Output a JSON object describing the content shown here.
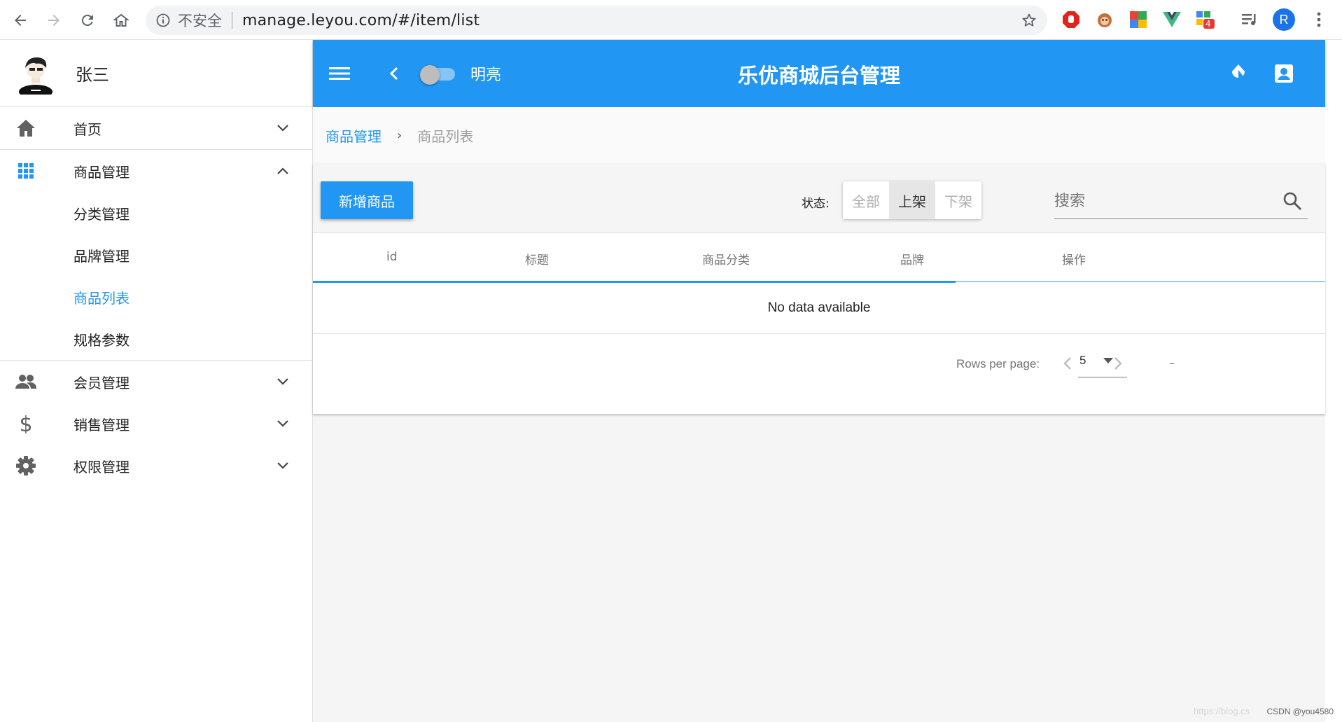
{
  "browser": {
    "security_label": "不安全",
    "url": "manage.leyou.com/#/item/list",
    "profile_initial": "R",
    "ext_badge": "4"
  },
  "sidebar": {
    "user_name": "张三",
    "items": [
      {
        "label": "首页",
        "icon": "home-icon",
        "expanded": false
      },
      {
        "label": "商品管理",
        "icon": "apps-grid-icon",
        "expanded": true,
        "children": [
          {
            "label": "分类管理",
            "active": false
          },
          {
            "label": "品牌管理",
            "active": false
          },
          {
            "label": "商品列表",
            "active": true
          },
          {
            "label": "规格参数",
            "active": false
          }
        ]
      },
      {
        "label": "会员管理",
        "icon": "people-icon",
        "expanded": false
      },
      {
        "label": "销售管理",
        "icon": "dollar-icon",
        "expanded": false
      },
      {
        "label": "权限管理",
        "icon": "gear-icon",
        "expanded": false
      }
    ]
  },
  "toolbar": {
    "theme_label": "明亮",
    "title": "乐优商城后台管理"
  },
  "breadcrumb": {
    "parent": "商品管理",
    "current": "商品列表"
  },
  "controls": {
    "add_button": "新增商品",
    "status_label": "状态:",
    "status_options": [
      {
        "label": "全部",
        "selected": false
      },
      {
        "label": "上架",
        "selected": true
      },
      {
        "label": "下架",
        "selected": false
      }
    ],
    "search_placeholder": "搜索"
  },
  "table": {
    "columns": [
      "id",
      "标题",
      "商品分类",
      "品牌",
      "操作"
    ],
    "loading_progress": 0.635,
    "empty_text": "No data available",
    "rows_per_page_label": "Rows per page:",
    "rows_per_page": "5",
    "range_text": "–"
  },
  "watermark": {
    "faint": "https://blog.cs",
    "text": "CSDN @you4580"
  },
  "colors": {
    "primary": "#2196f3",
    "primary_light": "#90caf9"
  }
}
